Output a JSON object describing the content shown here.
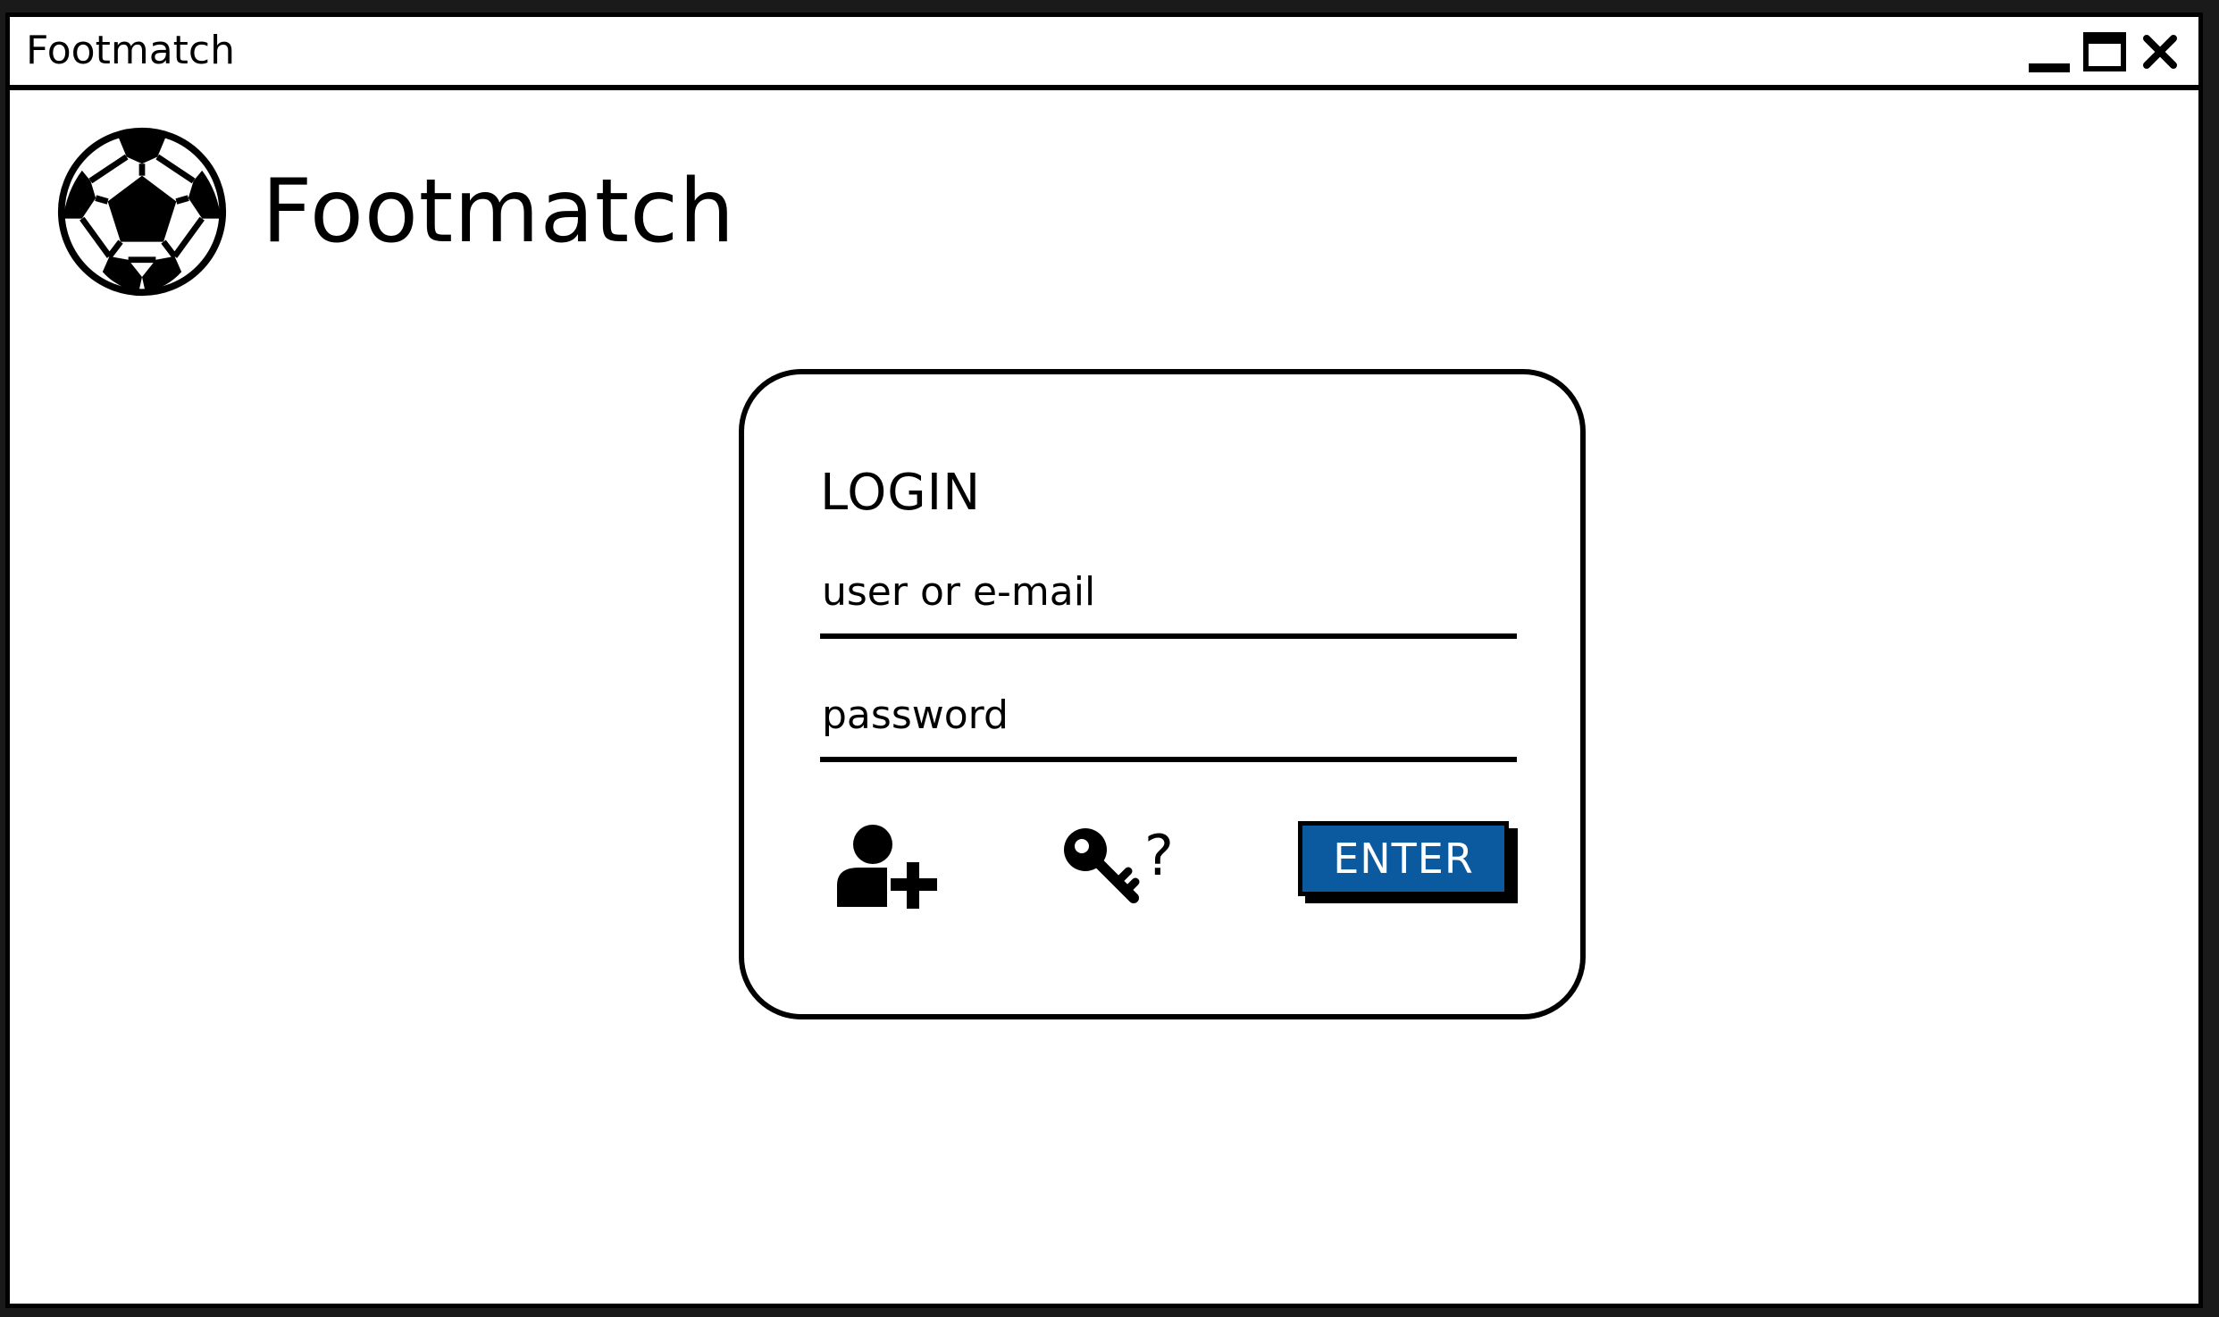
{
  "window": {
    "title": "Footmatch",
    "controls": {
      "minimize_icon": "minimize-icon",
      "maximize_icon": "maximize-icon",
      "close_icon": "close-icon"
    }
  },
  "header": {
    "logo_icon": "soccer-ball-icon",
    "app_name": "Footmatch"
  },
  "login": {
    "heading": "LOGIN",
    "user_field": {
      "placeholder": "user or e-mail",
      "value": ""
    },
    "password_field": {
      "placeholder": "password",
      "value": ""
    },
    "register_icon": "add-user-icon",
    "forgot_icon": "key-question-icon",
    "forgot_question_mark": "?",
    "enter_label": "ENTER"
  },
  "colors": {
    "accent": "#0b5aa0",
    "ink": "#000000",
    "background": "#ffffff"
  }
}
